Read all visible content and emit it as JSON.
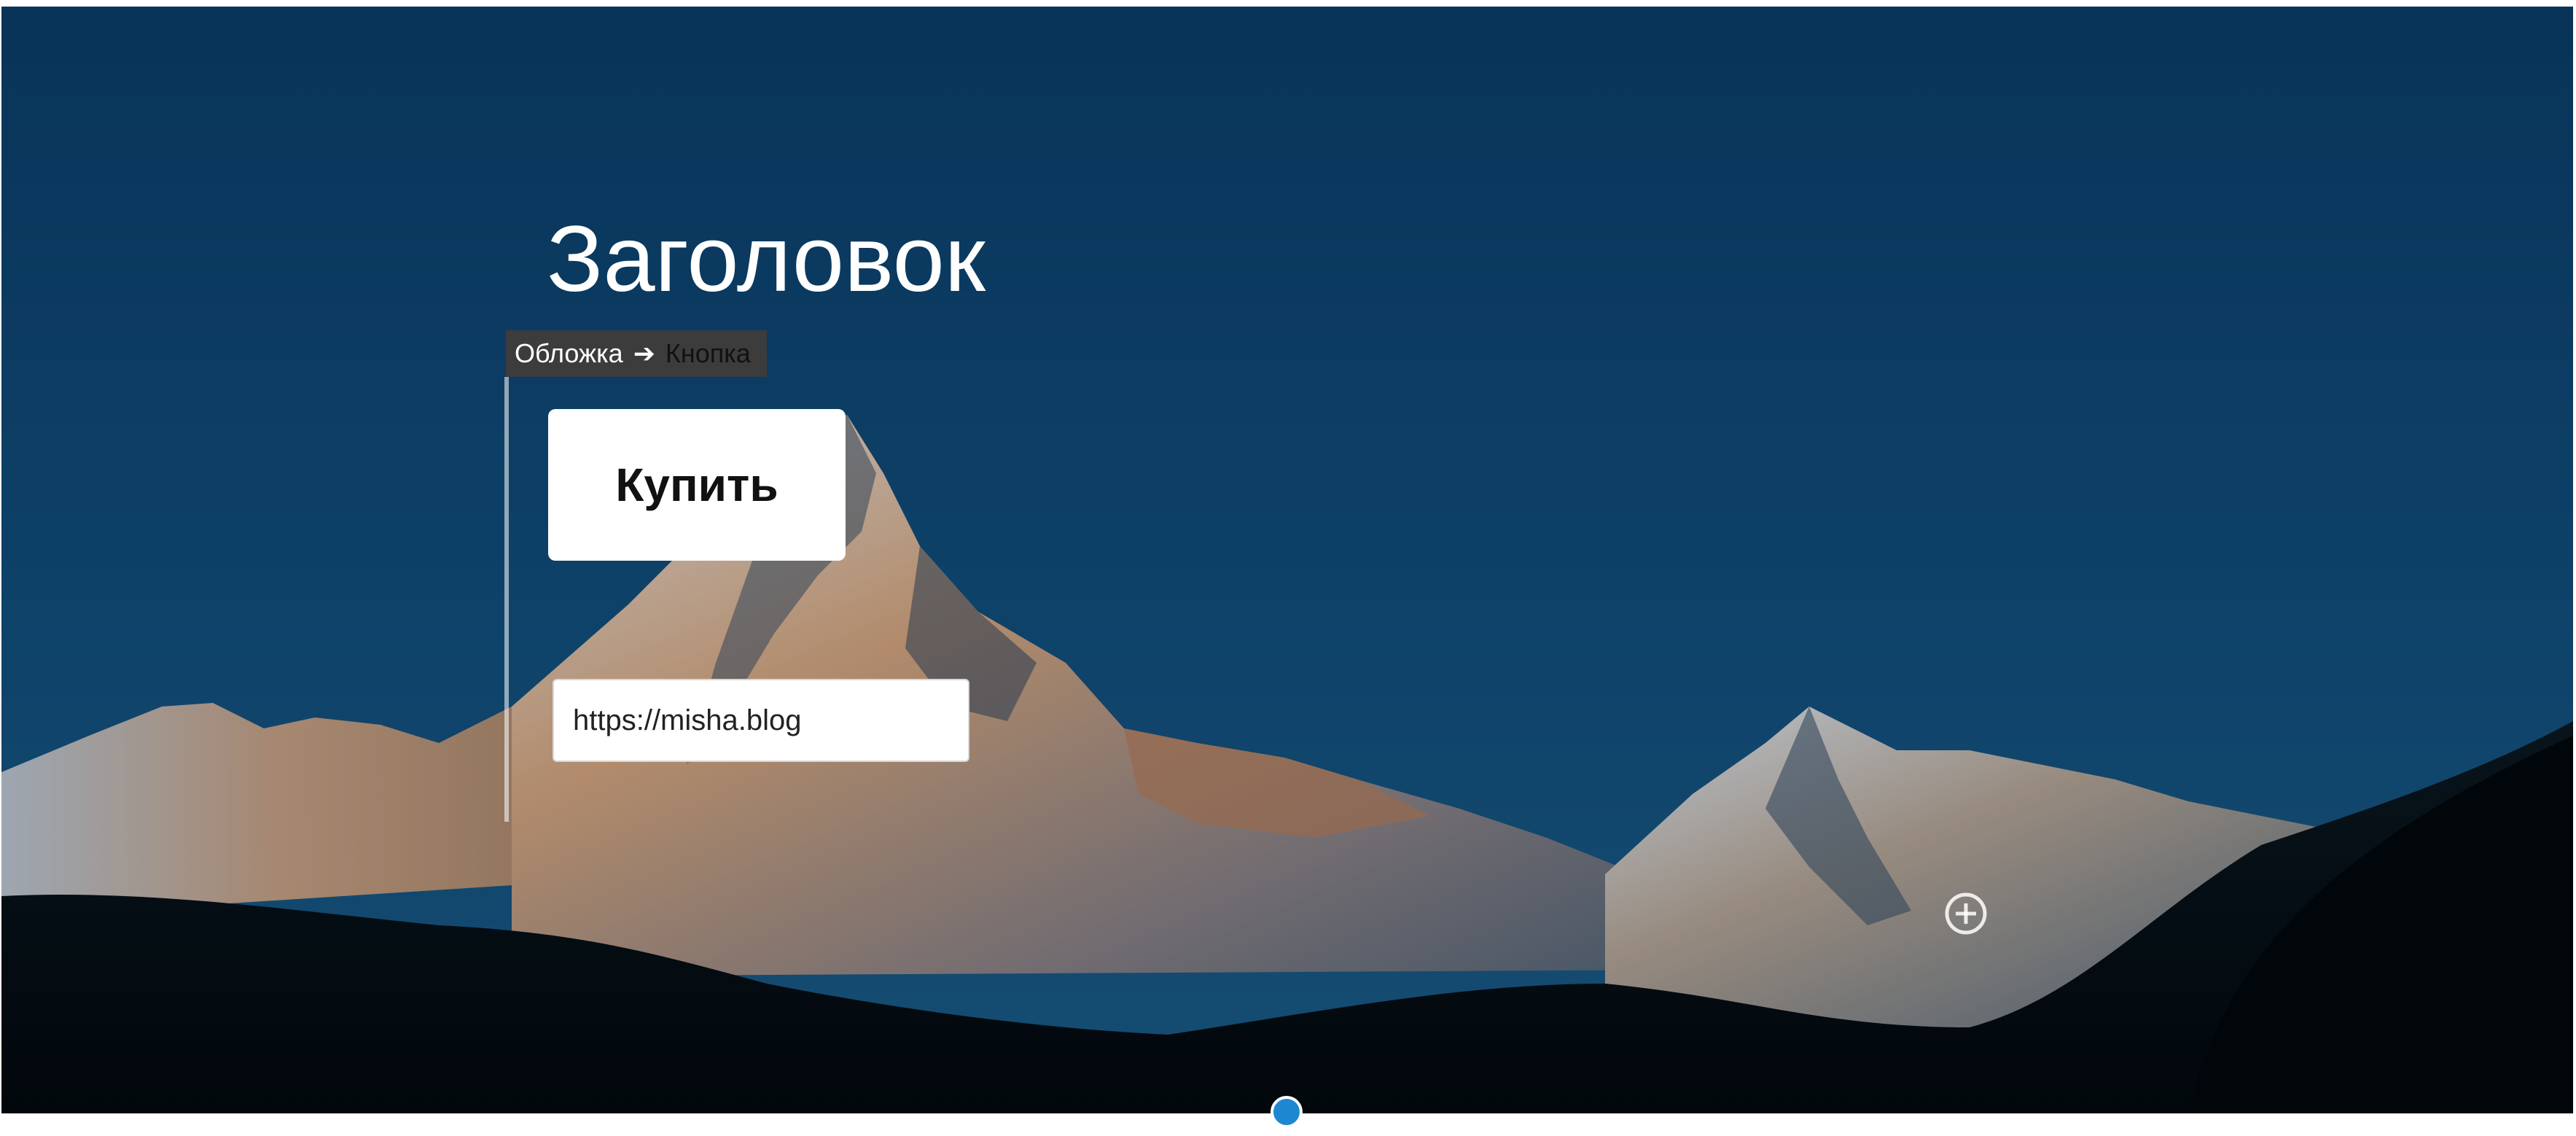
{
  "cover": {
    "heading": "Заголовок",
    "colors": {
      "sky_top": "#0c3d66",
      "sky_bottom": "#15517a",
      "mountain_light": "#e7dfd6",
      "mountain_warm": "#c8885a",
      "mountain_shadow": "#33485c",
      "forest": "#060a0c"
    }
  },
  "breadcrumb": {
    "parent": "Обложка",
    "arrow": "➔",
    "current": "Кнопка"
  },
  "button": {
    "label": "Купить",
    "background": "#ffffff",
    "text_color": "#111111"
  },
  "link_input": {
    "value": "https://misha.blog"
  },
  "controls": {
    "inserter_icon": "plus-circle-icon",
    "resize_handle_color": "#1e87d2"
  }
}
